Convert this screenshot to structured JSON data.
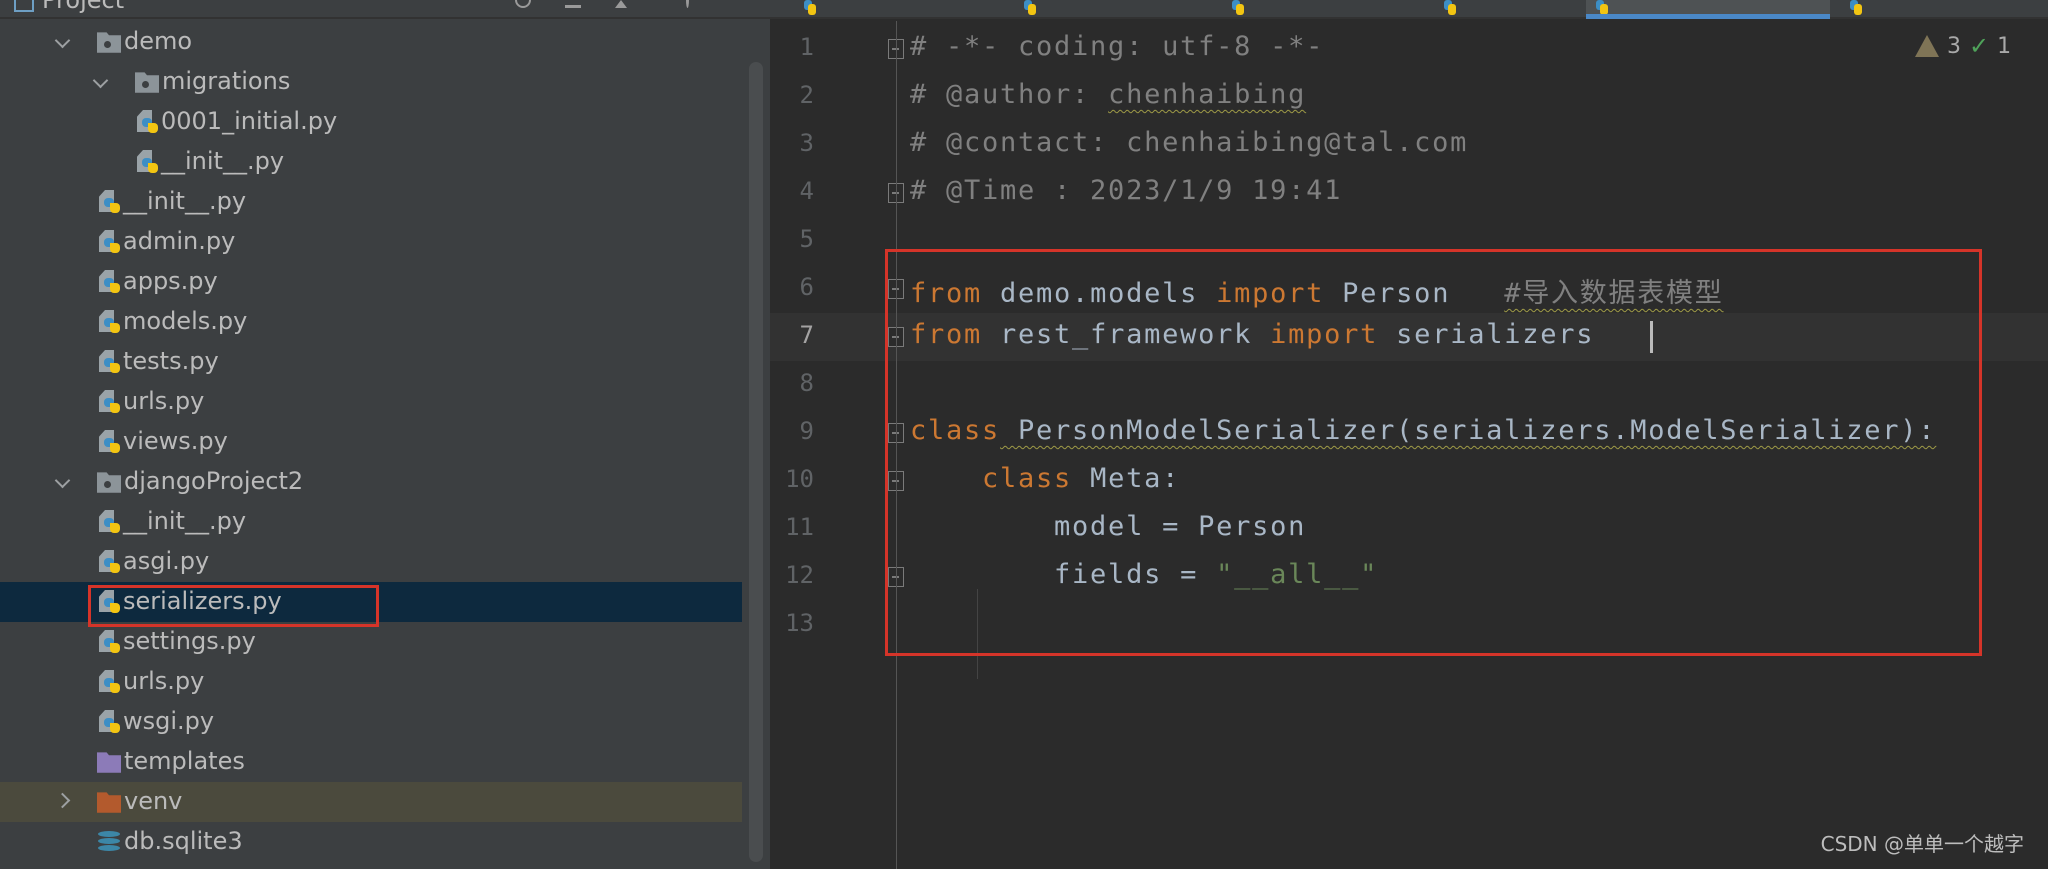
{
  "project_panel": {
    "title": "Project",
    "tree": [
      {
        "label": "demo",
        "icon": "folder-package-icon",
        "depth": 0,
        "chevron": "down"
      },
      {
        "label": "migrations",
        "icon": "folder-package-icon",
        "depth": 1,
        "chevron": "down"
      },
      {
        "label": "0001_initial.py",
        "icon": "python-file-icon",
        "depth": 2
      },
      {
        "label": "__init__.py",
        "icon": "python-file-icon",
        "depth": 2
      },
      {
        "label": "__init__.py",
        "icon": "python-file-icon",
        "depth": 1
      },
      {
        "label": "admin.py",
        "icon": "python-file-icon",
        "depth": 1
      },
      {
        "label": "apps.py",
        "icon": "python-file-icon",
        "depth": 1
      },
      {
        "label": "models.py",
        "icon": "python-file-icon",
        "depth": 1
      },
      {
        "label": "tests.py",
        "icon": "python-file-icon",
        "depth": 1
      },
      {
        "label": "urls.py",
        "icon": "python-file-icon",
        "depth": 1
      },
      {
        "label": "views.py",
        "icon": "python-file-icon",
        "depth": 1
      },
      {
        "label": "djangoProject2",
        "icon": "folder-package-icon",
        "depth": 0,
        "chevron": "down"
      },
      {
        "label": "__init__.py",
        "icon": "python-file-icon",
        "depth": 1
      },
      {
        "label": "asgi.py",
        "icon": "python-file-icon",
        "depth": 1
      },
      {
        "label": "serializers.py",
        "icon": "python-file-icon",
        "depth": 1,
        "selected": true
      },
      {
        "label": "settings.py",
        "icon": "python-file-icon",
        "depth": 1
      },
      {
        "label": "urls.py",
        "icon": "python-file-icon",
        "depth": 1
      },
      {
        "label": "wsgi.py",
        "icon": "python-file-icon",
        "depth": 1
      },
      {
        "label": "templates",
        "icon": "folder-templates-icon",
        "depth": 0
      },
      {
        "label": "venv",
        "icon": "folder-excluded-icon",
        "depth": 0,
        "chevron": "right",
        "highlighted": true
      },
      {
        "label": "db.sqlite3",
        "icon": "database-icon",
        "depth": 0
      }
    ]
  },
  "editor": {
    "inspections": {
      "warnings": "3",
      "weak_warnings": "1"
    },
    "current_line": 7,
    "lines": [
      {
        "n": "1",
        "fold": true,
        "tokens": [
          {
            "text": "# -*- coding: utf-8 -*-",
            "cls": "c"
          }
        ]
      },
      {
        "n": "2",
        "tokens": [
          {
            "text": "# @author: ",
            "cls": "c"
          },
          {
            "text": "chenhaibing",
            "cls": "c wavy"
          }
        ]
      },
      {
        "n": "3",
        "tokens": [
          {
            "text": "# @contact: chenhaibing@tal.com",
            "cls": "c"
          }
        ]
      },
      {
        "n": "4",
        "fold": true,
        "tokens": [
          {
            "text": "# @Time : 2023/1/9 19:41",
            "cls": "c"
          }
        ]
      },
      {
        "n": "5",
        "tokens": []
      },
      {
        "n": "6",
        "fold": true,
        "tokens": [
          {
            "text": "from",
            "cls": "k"
          },
          {
            "text": " demo.models ",
            "cls": "t"
          },
          {
            "text": "import",
            "cls": "k"
          },
          {
            "text": " Person   ",
            "cls": "t"
          },
          {
            "text": "#导入数据表模型",
            "cls": "c wavy"
          }
        ]
      },
      {
        "n": "7",
        "fold": true,
        "tokens": [
          {
            "text": "from",
            "cls": "k"
          },
          {
            "text": " rest_framework ",
            "cls": "t"
          },
          {
            "text": "import",
            "cls": "k"
          },
          {
            "text": " serializers",
            "cls": "t"
          }
        ]
      },
      {
        "n": "8",
        "tokens": []
      },
      {
        "n": "9",
        "fold": true,
        "tokens": [
          {
            "text": "class",
            "cls": "k"
          },
          {
            "text": " PersonModelSerializer(serializers.ModelSerializer):",
            "cls": "t wavy"
          }
        ]
      },
      {
        "n": "10",
        "fold": true,
        "tokens": [
          {
            "text": "    ",
            "cls": "t"
          },
          {
            "text": "class",
            "cls": "k"
          },
          {
            "text": " Meta:",
            "cls": "t"
          }
        ]
      },
      {
        "n": "11",
        "tokens": [
          {
            "text": "        model = Person",
            "cls": "t"
          }
        ]
      },
      {
        "n": "12",
        "fold": true,
        "tokens": [
          {
            "text": "        fields = ",
            "cls": "t"
          },
          {
            "text": "\"__all__\"",
            "cls": "s"
          }
        ]
      },
      {
        "n": "13",
        "tokens": []
      }
    ]
  },
  "watermark": "CSDN @单单一个越字",
  "colors": {
    "keyword": "#cc7832",
    "text": "#a9b7c6",
    "comment": "#808080",
    "string": "#6a8759",
    "annotation_box": "#d53429",
    "selection": "#0d293e"
  }
}
